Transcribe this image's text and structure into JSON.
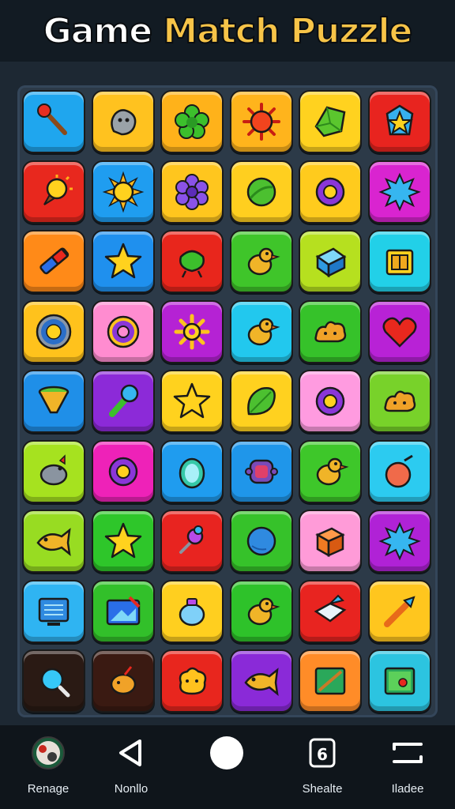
{
  "header": {
    "title_parts": [
      "Game",
      "Match",
      "Puzzle"
    ],
    "title_colors": [
      "#ffffff",
      "#f7c448",
      "#f7c448"
    ]
  },
  "board": {
    "rows": 9,
    "cols": 6,
    "tiles": [
      [
        {
          "color": "#1fa6ee",
          "icon": "matchstick-icon"
        },
        {
          "color": "#ffc21f",
          "icon": "rock-creature-icon"
        },
        {
          "color": "#ffb21a",
          "icon": "green-flower-icon"
        },
        {
          "color": "#ffb41c",
          "icon": "red-sun-icon"
        },
        {
          "color": "#ffd21f",
          "icon": "green-gem-icon"
        },
        {
          "color": "#e8241f",
          "icon": "blue-star-gem-icon"
        }
      ],
      [
        {
          "color": "#e8281e",
          "icon": "sun-cone-icon"
        },
        {
          "color": "#1f9df0",
          "icon": "sun-icon"
        },
        {
          "color": "#ffc61e",
          "icon": "purple-flower-icon"
        },
        {
          "color": "#ffcf1f",
          "icon": "green-orb-icon"
        },
        {
          "color": "#ffcb1d",
          "icon": "purple-ring-icon"
        },
        {
          "color": "#d924d0",
          "icon": "blue-splat-icon"
        }
      ],
      [
        {
          "color": "#ff8a18",
          "icon": "marker-icon"
        },
        {
          "color": "#1f90ee",
          "icon": "yellow-star-icon"
        },
        {
          "color": "#e8261c",
          "icon": "green-bug-icon"
        },
        {
          "color": "#3fc52a",
          "icon": "duck-icon"
        },
        {
          "color": "#b6e01f",
          "icon": "blue-cube-icon"
        },
        {
          "color": "#22d0e8",
          "icon": "yellow-box-icon"
        }
      ],
      [
        {
          "color": "#ffc21c",
          "icon": "sun-badge-icon"
        },
        {
          "color": "#ff8cd0",
          "icon": "donut-icon"
        },
        {
          "color": "#b522d4",
          "icon": "gear-flower-icon"
        },
        {
          "color": "#22c8ee",
          "icon": "duck-icon"
        },
        {
          "color": "#36c22a",
          "icon": "orange-blob-icon"
        },
        {
          "color": "#b822d6",
          "icon": "heart-icon"
        }
      ],
      [
        {
          "color": "#1f8fe8",
          "icon": "funnel-icon"
        },
        {
          "color": "#8c2ad8",
          "icon": "wand-icon"
        },
        {
          "color": "#ffd21e",
          "icon": "yellow-star-icon"
        },
        {
          "color": "#ffd11f",
          "icon": "green-leaf-icon"
        },
        {
          "color": "#ff9be0",
          "icon": "purple-ring-icon"
        },
        {
          "color": "#78d22a",
          "icon": "orange-blob-icon"
        }
      ],
      [
        {
          "color": "#a6e21f",
          "icon": "bird-icon"
        },
        {
          "color": "#ee22b8",
          "icon": "purple-ring-icon"
        },
        {
          "color": "#1f9cef",
          "icon": "egg-icon"
        },
        {
          "color": "#1f96ea",
          "icon": "purple-creature-icon"
        },
        {
          "color": "#3ec72a",
          "icon": "duck-icon"
        },
        {
          "color": "#2ccbf0",
          "icon": "apple-icon"
        }
      ],
      [
        {
          "color": "#98dc22",
          "icon": "fish-icon"
        },
        {
          "color": "#2ec62a",
          "icon": "yellow-star-icon"
        },
        {
          "color": "#e82420",
          "icon": "pin-icon"
        },
        {
          "color": "#36c22a",
          "icon": "blue-ball-icon"
        },
        {
          "color": "#ff9bd8",
          "icon": "orange-cube-icon"
        },
        {
          "color": "#b022d6",
          "icon": "blue-splat-icon"
        }
      ],
      [
        {
          "color": "#2fb4f2",
          "icon": "computer-icon"
        },
        {
          "color": "#32c02a",
          "icon": "picture-icon"
        },
        {
          "color": "#ffcf1f",
          "icon": "lantern-icon"
        },
        {
          "color": "#2ec22a",
          "icon": "duck-icon"
        },
        {
          "color": "#e82420",
          "icon": "crystal-box-icon"
        },
        {
          "color": "#ffc61e",
          "icon": "rocket-icon"
        }
      ],
      [
        {
          "color": "#2a1a14",
          "icon": "magnifier-icon"
        },
        {
          "color": "#3a1a12",
          "icon": "orange-fruit-icon"
        },
        {
          "color": "#e8261e",
          "icon": "yellow-blob-icon"
        },
        {
          "color": "#8a2ad8",
          "icon": "fish-icon"
        },
        {
          "color": "#ff8c28",
          "icon": "green-card-icon"
        },
        {
          "color": "#2cc4e0",
          "icon": "map-icon"
        }
      ]
    ]
  },
  "nav": {
    "items": [
      {
        "label": "Renage",
        "icon": "avatar-icon"
      },
      {
        "label": "Nonllo",
        "icon": "back-triangle-icon"
      },
      {
        "label": "",
        "icon": "home-circle-icon"
      },
      {
        "label": "Shealte",
        "icon": "recent-apps-icon"
      },
      {
        "label": "Iladee",
        "icon": "menu-bars-icon"
      }
    ]
  }
}
